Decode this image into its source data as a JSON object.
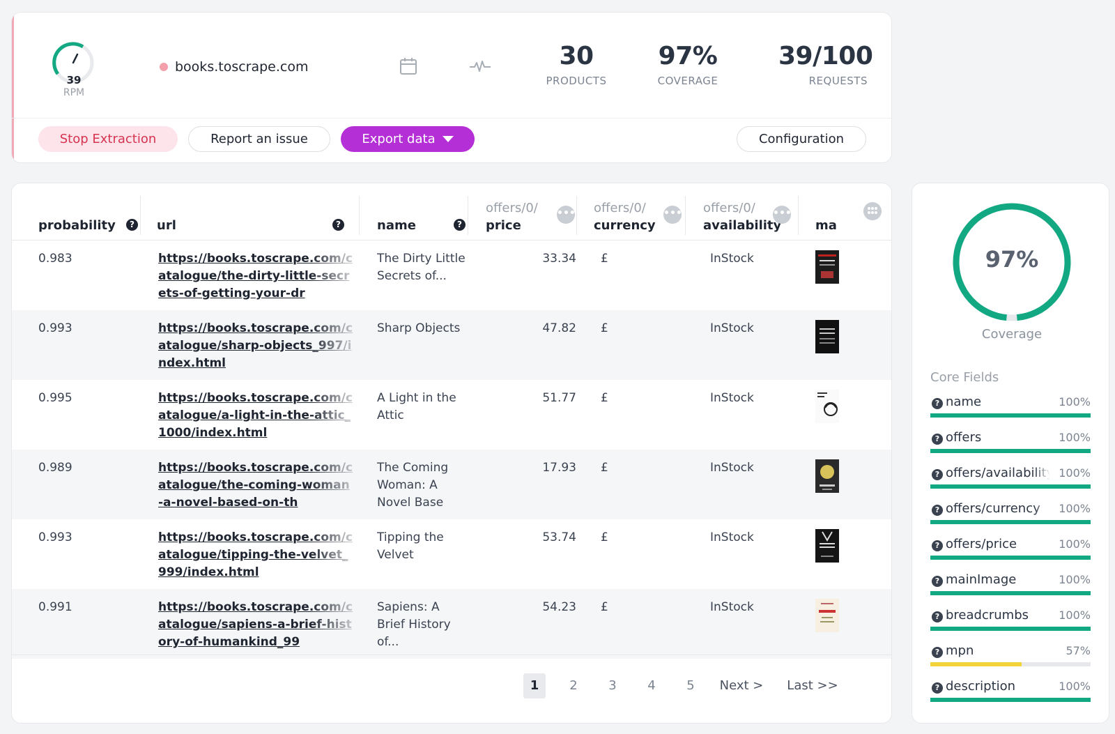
{
  "header": {
    "rpm_value": "39",
    "rpm_label": "RPM",
    "site": "books.toscrape.com",
    "stats": [
      {
        "value": "30",
        "label": "PRODUCTS"
      },
      {
        "value": "97%",
        "label": "COVERAGE"
      },
      {
        "value": "39/100",
        "label": "REQUESTS"
      }
    ]
  },
  "actions": {
    "stop": "Stop Extraction",
    "report": "Report an issue",
    "export": "Export data",
    "config": "Configuration"
  },
  "table": {
    "columns": {
      "probability": "probability",
      "url": "url",
      "name": "name",
      "price_pre": "offers/0/",
      "price": "price",
      "currency_pre": "offers/0/",
      "currency": "currency",
      "availability_pre": "offers/0/",
      "availability": "availability",
      "mainimage": "ma"
    },
    "rows": [
      {
        "probability": "0.983",
        "url": "https://books.toscrape.com/catalogue/the-dirty-little-secrets-of-getting-your-dr",
        "name": "The Dirty Little Secrets of...",
        "price": "33.34",
        "currency": "£",
        "availability": "InStock"
      },
      {
        "probability": "0.993",
        "url": "https://books.toscrape.com/catalogue/sharp-objects_997/index.html",
        "name": "Sharp Objects",
        "price": "47.82",
        "currency": "£",
        "availability": "InStock"
      },
      {
        "probability": "0.995",
        "url": "https://books.toscrape.com/catalogue/a-light-in-the-attic_1000/index.html",
        "name": "A Light in the Attic",
        "price": "51.77",
        "currency": "£",
        "availability": "InStock"
      },
      {
        "probability": "0.989",
        "url": "https://books.toscrape.com/catalogue/the-coming-woman-a-novel-based-on-th",
        "name": "The Coming Woman: A Novel Base",
        "price": "17.93",
        "currency": "£",
        "availability": "InStock"
      },
      {
        "probability": "0.993",
        "url": "https://books.toscrape.com/catalogue/tipping-the-velvet_999/index.html",
        "name": "Tipping the Velvet",
        "price": "53.74",
        "currency": "£",
        "availability": "InStock"
      },
      {
        "probability": "0.991",
        "url": "https://books.toscrape.com/catalogue/sapiens-a-brief-history-of-humankind_99",
        "name": "Sapiens: A Brief History of...",
        "price": "54.23",
        "currency": "£",
        "availability": "InStock"
      }
    ]
  },
  "pagination": {
    "pages": [
      "1",
      "2",
      "3",
      "4",
      "5"
    ],
    "current": "1",
    "next": "Next >",
    "last": "Last >>"
  },
  "coverage": {
    "value": "97%",
    "percent": 97,
    "label": "Coverage",
    "core_title": "Core Fields",
    "fields": [
      {
        "name": "name",
        "pct": "100%",
        "value": 100
      },
      {
        "name": "offers",
        "pct": "100%",
        "value": 100
      },
      {
        "name": "offers/availability",
        "pct": "100%",
        "value": 100
      },
      {
        "name": "offers/currency",
        "pct": "100%",
        "value": 100
      },
      {
        "name": "offers/price",
        "pct": "100%",
        "value": 100
      },
      {
        "name": "mainImage",
        "pct": "100%",
        "value": 100
      },
      {
        "name": "breadcrumbs",
        "pct": "100%",
        "value": 100
      },
      {
        "name": "mpn",
        "pct": "57%",
        "value": 57
      },
      {
        "name": "description",
        "pct": "100%",
        "value": 100
      }
    ]
  },
  "colors": {
    "accent": "#b52fd6",
    "success": "#12a982",
    "warning": "#f2d33a",
    "danger": "#d6334f"
  }
}
